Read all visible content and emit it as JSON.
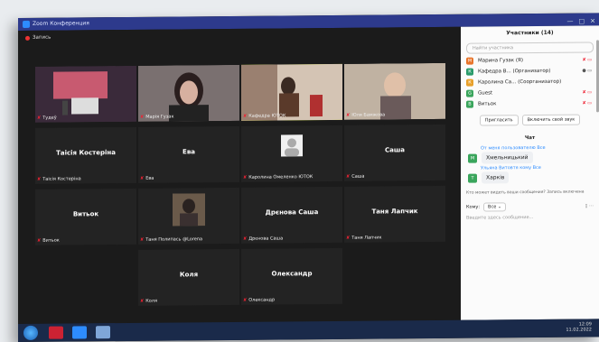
{
  "window": {
    "title": "Zoom Конференция",
    "recording": "Запись"
  },
  "tiles": [
    {
      "name": "",
      "label": "Тудеў"
    },
    {
      "name": "",
      "label": "Марія Гузак"
    },
    {
      "name": "",
      "label": "Кафедра ЮТОК"
    },
    {
      "name": "",
      "label": "Юля Бамжова"
    },
    {
      "name": "Таісія Костеріна",
      "label": "Таісія Костеріна"
    },
    {
      "name": "Ева",
      "label": "Ева"
    },
    {
      "name": "",
      "label": "Каролина Омеленко ЮТОК"
    },
    {
      "name": "Саша",
      "label": "Саша"
    },
    {
      "name": "Витьок",
      "label": "Витьок"
    },
    {
      "name": "",
      "label": "Таня Полипась @Lorena"
    },
    {
      "name": "Дрєнова Саша",
      "label": "Дрєнова Саша"
    },
    {
      "name": "Таня Лапчик",
      "label": "Таня Лапчик"
    },
    {
      "name": "Коля",
      "label": "Коля"
    },
    {
      "name": "Олександр",
      "label": "Олександр"
    }
  ],
  "panel": {
    "title": "Участники (14)",
    "search_placeholder": "Найти участника",
    "participants": [
      {
        "initial": "М",
        "name": "Марина Гузак (Я)",
        "color": "#e8742a"
      },
      {
        "initial": "К",
        "name": "Кафедра В... (Организатор)",
        "color": "#2a9b6b"
      },
      {
        "initial": "К",
        "name": "Каролина Са... (Соорганизатор)",
        "color": "#e8a02a"
      },
      {
        "initial": "G",
        "name": "Guest",
        "color": "#3aa55c"
      },
      {
        "initial": "В",
        "name": "Витьок",
        "color": "#3aa55c"
      }
    ],
    "invite_label": "Пригласить",
    "unmute_label": "Включить свой звук",
    "chat_title": "Чат",
    "messages": [
      {
        "from": "От меня пользователю Все",
        "initial": "М",
        "text": "Хмельницький",
        "color": "#3aa55c"
      },
      {
        "from": "Ульяна Витовтя кому Все",
        "initial": "Т",
        "text": "Харків",
        "color": "#3aa55c"
      }
    ],
    "hint": "Кто может видеть ваши сообщения? Запись включена",
    "to_label": "Кому:",
    "to_value": "Все",
    "input_placeholder": "Введите здесь сообщение..."
  },
  "tray": {
    "time": "12:09",
    "date": "11.02.2022"
  }
}
